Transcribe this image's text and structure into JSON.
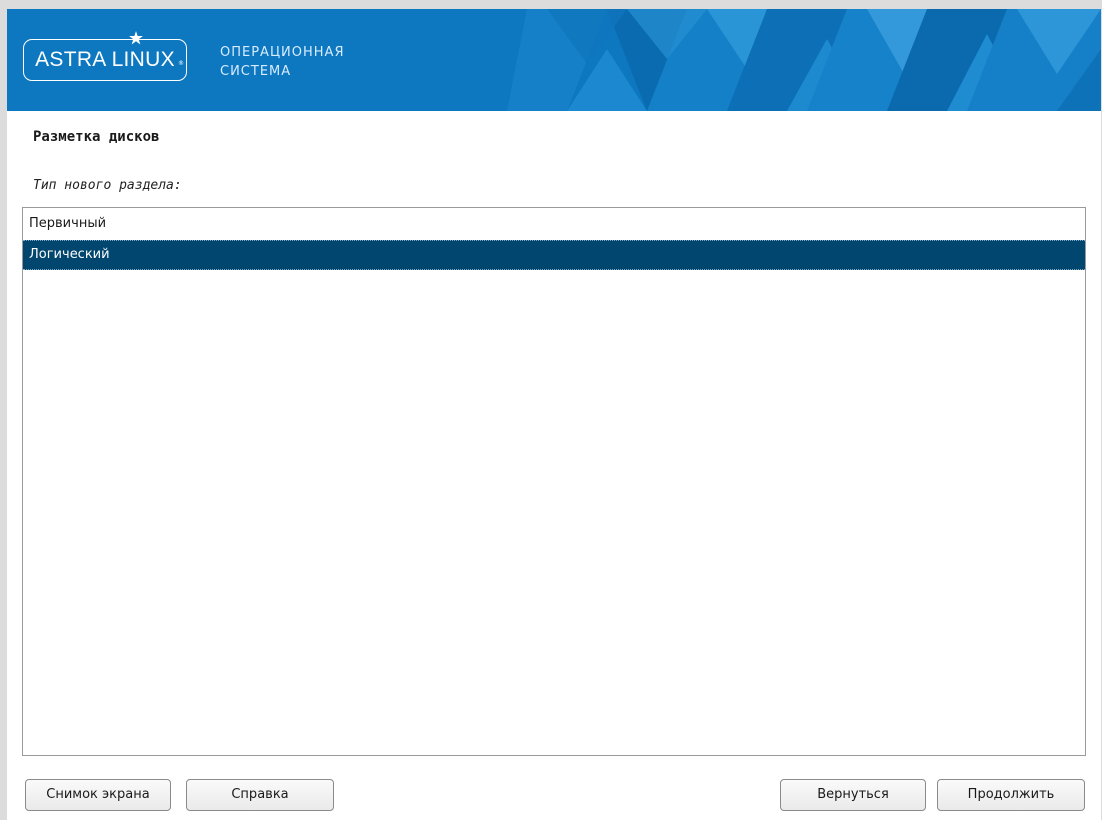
{
  "banner": {
    "logo_text": "ASTRA LINUX",
    "logo_mark": "®",
    "subtitle_line1": "ОПЕРАЦИОННАЯ",
    "subtitle_line2": "СИСТЕМА",
    "color": "#0d77c0"
  },
  "page": {
    "title": "Разметка дисков",
    "prompt": "Тип нового раздела:"
  },
  "list": {
    "items": [
      {
        "label": "Первичный",
        "selected": false
      },
      {
        "label": "Логический",
        "selected": true
      }
    ],
    "selected_color": "#01466f"
  },
  "buttons": {
    "screenshot": "Снимок экрана",
    "help": "Справка",
    "back": "Вернуться",
    "continue": "Продолжить"
  },
  "icons": {
    "logo_star": "star-icon"
  }
}
